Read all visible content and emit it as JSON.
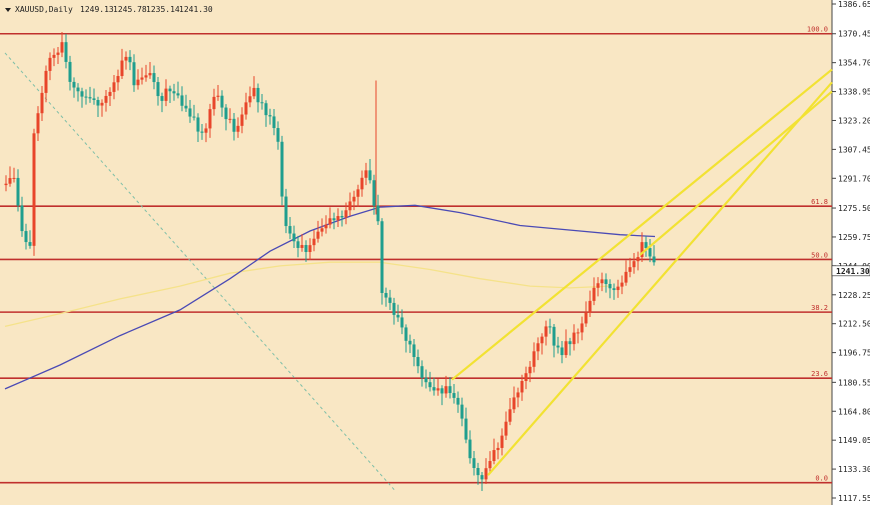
{
  "chart_header": {
    "symbol_text": "XAUUSD,Daily",
    "ohlc_values": [
      "1249.13",
      "1245.78",
      "1235.14",
      "1241.30"
    ]
  },
  "chart_data": {
    "type": "candlestick",
    "symbol": "XAUUSD",
    "timeframe": "Daily",
    "y_axis_ticks": [
      "1386.65",
      "1370.45",
      "1354.70",
      "1338.95",
      "1323.20",
      "1307.45",
      "1291.70",
      "1275.50",
      "1259.75",
      "1244.00",
      "1228.25",
      "1212.50",
      "1196.75",
      "1180.55",
      "1164.80",
      "1149.05",
      "1133.30",
      "1117.55"
    ],
    "ylim": [
      1117.55,
      1386.65
    ],
    "current_price": "1241.30",
    "fibonacci_levels": [
      {
        "label": "100.0",
        "price": 1370.45
      },
      {
        "label": "61.8",
        "price": 1276.5
      },
      {
        "label": "50.0",
        "price": 1247.5
      },
      {
        "label": "38.2",
        "price": 1218.8
      },
      {
        "label": "23.6",
        "price": 1182.8
      },
      {
        "label": "0.0",
        "price": 1125.9
      }
    ],
    "colors": {
      "background": "#f9e7c4",
      "bull": "#e8452a",
      "bear": "#1f9e8e",
      "fib_line": "#c0302d",
      "ma_long": "#4a4ab5",
      "ma_short": "#f5e28a",
      "trendline": "#f2e233",
      "diagonal": "#7fbfa8"
    }
  }
}
